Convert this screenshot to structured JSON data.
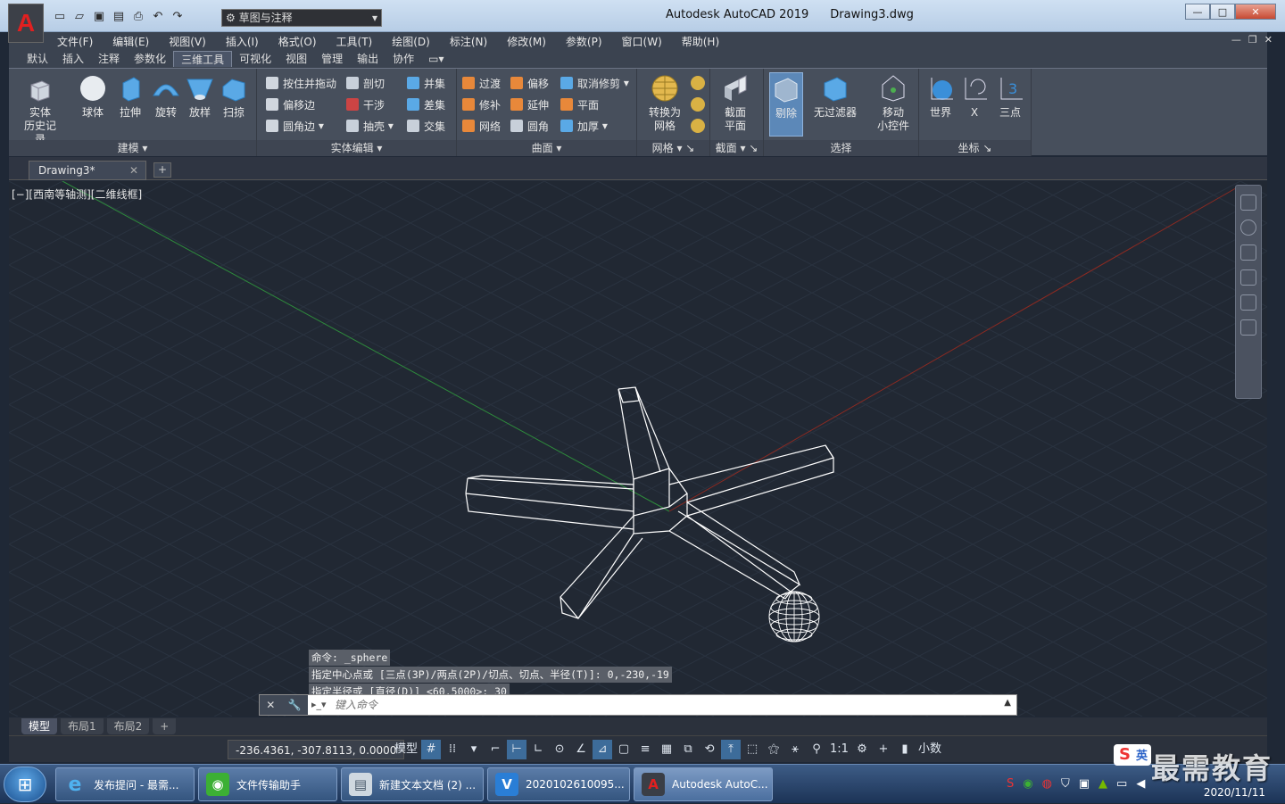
{
  "window": {
    "app_name": "Autodesk AutoCAD 2019",
    "doc_name": "Drawing3.dwg",
    "workspace": "草图与注释",
    "controls": {
      "minimize": "—",
      "maximize": "□",
      "close": "✕"
    }
  },
  "menu": [
    "文件(F)",
    "编辑(E)",
    "视图(V)",
    "插入(I)",
    "格式(O)",
    "工具(T)",
    "绘图(D)",
    "标注(N)",
    "修改(M)",
    "参数(P)",
    "窗口(W)",
    "帮助(H)"
  ],
  "ribbon_tabs": [
    "默认",
    "插入",
    "注释",
    "参数化",
    "三维工具",
    "可视化",
    "视图",
    "管理",
    "输出",
    "协作"
  ],
  "active_ribbon_tab": "三维工具",
  "ribbon": {
    "modeling": {
      "title": "建模",
      "buttons": [
        "实体\n历史记录",
        "球体",
        "拉伸",
        "旋转",
        "放样",
        "扫掠"
      ]
    },
    "solid_edit": {
      "title": "实体编辑",
      "col1": [
        "按住并拖动",
        "偏移边",
        "圆角边"
      ],
      "col2": [
        "剖切",
        "干涉",
        "抽壳"
      ],
      "col3": [
        "并集",
        "差集",
        "交集"
      ]
    },
    "surface": {
      "title": "曲面",
      "col1": [
        "过渡",
        "修补",
        "网络"
      ],
      "col2": [
        "偏移",
        "延伸",
        "圆角"
      ],
      "col3": [
        "取消修剪",
        "平面",
        "加厚"
      ]
    },
    "mesh": {
      "title": "网格",
      "button": "转换为\n网格"
    },
    "section": {
      "title": "截面",
      "button": "截面\n平面"
    },
    "selection": {
      "title": "选择",
      "buttons": [
        "剔除",
        "无过滤器",
        "移动\n小控件"
      ]
    },
    "ucs": {
      "title": "坐标",
      "buttons": [
        "世界",
        "X",
        "三点"
      ]
    }
  },
  "doc_tab": "Drawing3*",
  "viewport_label": "[−][西南等轴测][二维线框]",
  "command": {
    "history": [
      "命令: _sphere",
      "指定中心点或 [三点(3P)/两点(2P)/切点、切点、半径(T)]: 0,-230,-19",
      "指定半径或 [直径(D)] <60.5000>: 30"
    ],
    "placeholder": "键入命令"
  },
  "layout_tabs": [
    "模型",
    "布局1",
    "布局2"
  ],
  "status": {
    "coords": "-236.4361, -307.8113, 0.0000",
    "model": "模型",
    "scale": "1:1",
    "units": "小数"
  },
  "taskbar": {
    "items": [
      "发布提问 - 最需...",
      "文件传输助手",
      "新建文本文档 (2) ...",
      "2020102610095...",
      "Autodesk AutoC..."
    ],
    "date": "2020/11/11"
  },
  "watermark": "最需教育",
  "ime": {
    "logo": "S",
    "mode": "英"
  },
  "colors": {
    "x_axis": "#c0392b",
    "y_axis": "#2e8b3c",
    "grid": "#2a3340",
    "wire": "#ffffff",
    "active_tab": "#3d6c9a"
  }
}
